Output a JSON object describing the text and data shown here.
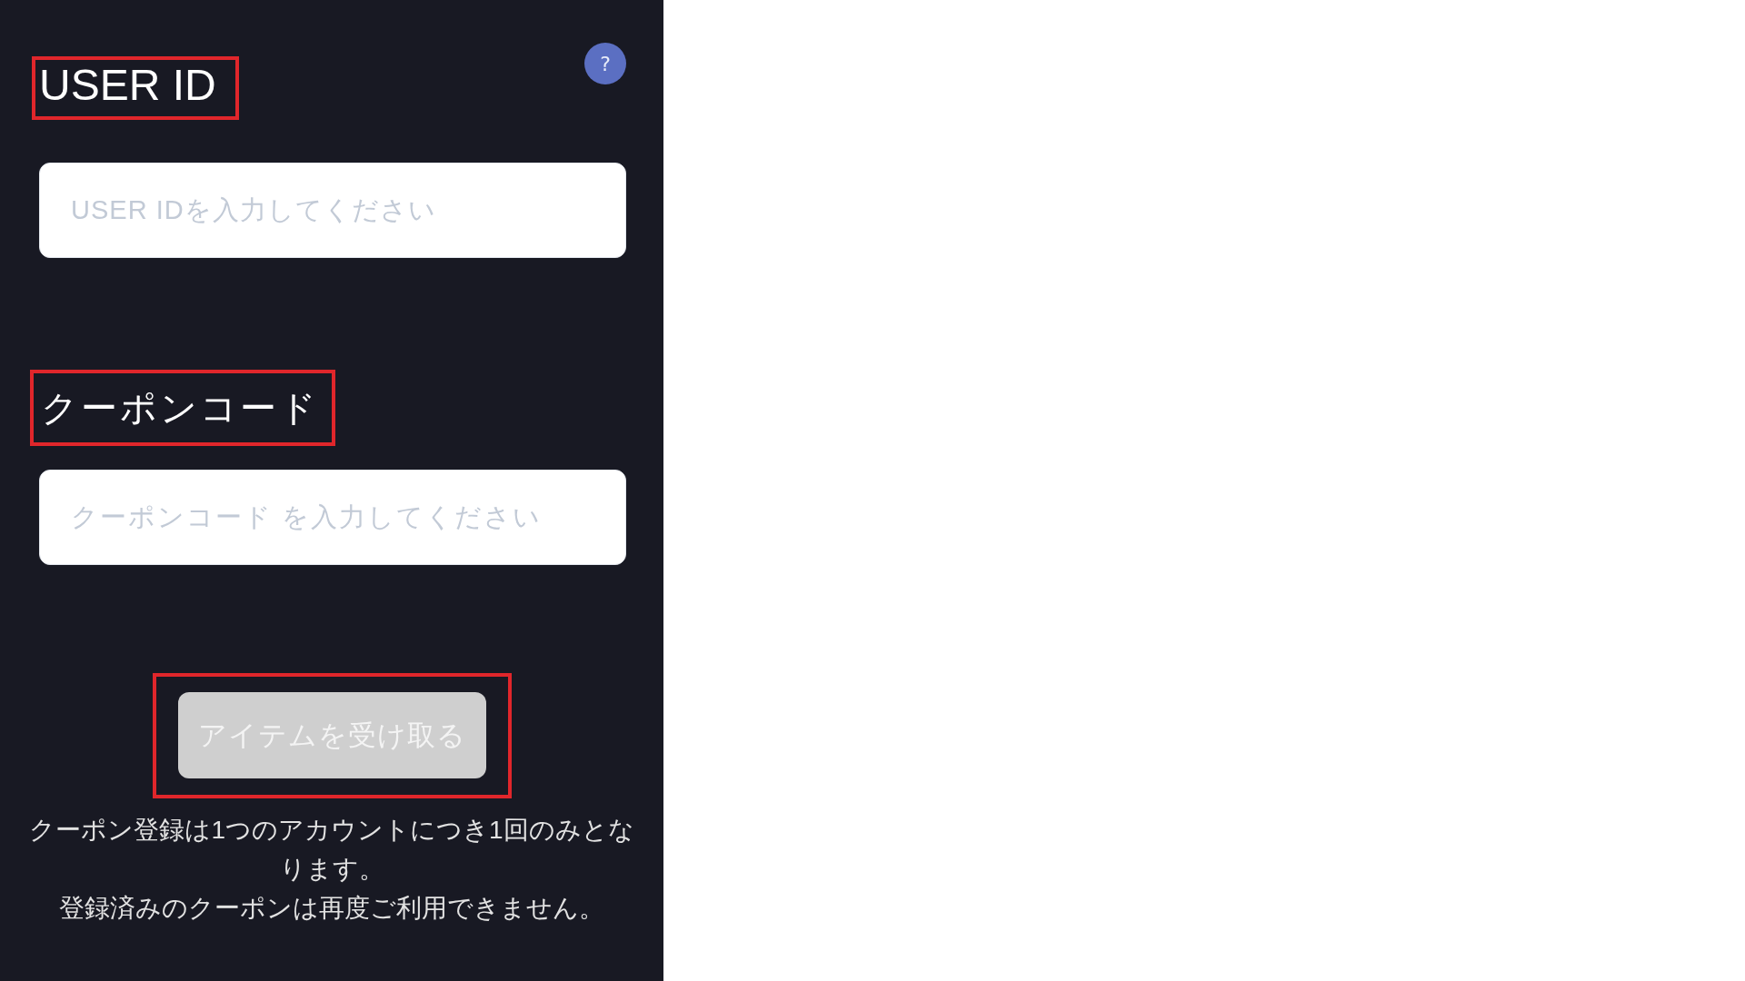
{
  "help_button": {
    "label": "?"
  },
  "fields": [
    {
      "label": "USER ID",
      "placeholder": "USER IDを入力してください",
      "highlighted": true
    },
    {
      "label": "クーポンコード",
      "placeholder": "クーポンコード を入力してください",
      "highlighted": true
    }
  ],
  "submit_button": {
    "label": "アイテムを受け取る",
    "disabled": true,
    "highlighted": true
  },
  "notes": [
    "クーポン登録は1つのアカウントにつき1回のみとなります。",
    "登録済みのクーポンは再度ご利用できません。"
  ]
}
